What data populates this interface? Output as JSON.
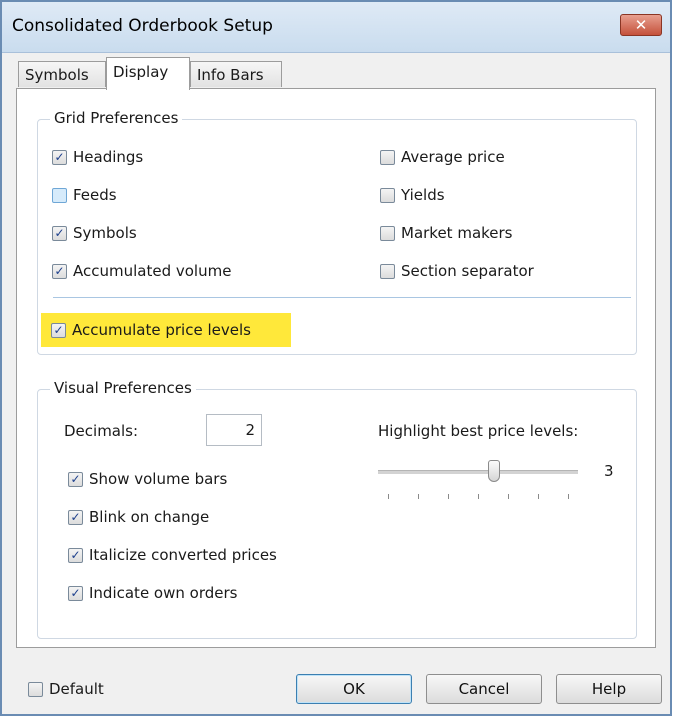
{
  "window": {
    "title": "Consolidated Orderbook Setup",
    "close_glyph": "✕"
  },
  "tabs": [
    {
      "label": "Symbols",
      "active": false
    },
    {
      "label": "Display",
      "active": true
    },
    {
      "label": "Info Bars",
      "active": false
    }
  ],
  "grid_preferences": {
    "title": "Grid Preferences",
    "left_items": [
      {
        "label": "Headings",
        "checked": true
      },
      {
        "label": "Feeds",
        "checked": false
      },
      {
        "label": "Symbols",
        "checked": true
      },
      {
        "label": "Accumulated volume",
        "checked": true
      }
    ],
    "right_items": [
      {
        "label": "Average price",
        "checked": false
      },
      {
        "label": "Yields",
        "checked": false
      },
      {
        "label": "Market makers",
        "checked": false
      },
      {
        "label": "Section separator",
        "checked": false
      }
    ],
    "highlighted_item": {
      "label": "Accumulate price levels",
      "checked": true
    },
    "highlight_color": "#ffe83a"
  },
  "visual_preferences": {
    "title": "Visual Preferences",
    "decimals_label": "Decimals:",
    "decimals_value": "2",
    "highlight_label": "Highlight best price levels:",
    "highlight_value": "3",
    "slider_fraction": 0.58,
    "items": [
      {
        "label": "Show volume bars",
        "checked": true
      },
      {
        "label": "Blink on change",
        "checked": true
      },
      {
        "label": "Italicize converted prices",
        "checked": true
      },
      {
        "label": "Indicate own orders",
        "checked": true
      }
    ]
  },
  "footer": {
    "default_label": "Default",
    "default_checked": false,
    "ok_label": "OK",
    "cancel_label": "Cancel",
    "help_label": "Help"
  },
  "check_glyph": "✓"
}
